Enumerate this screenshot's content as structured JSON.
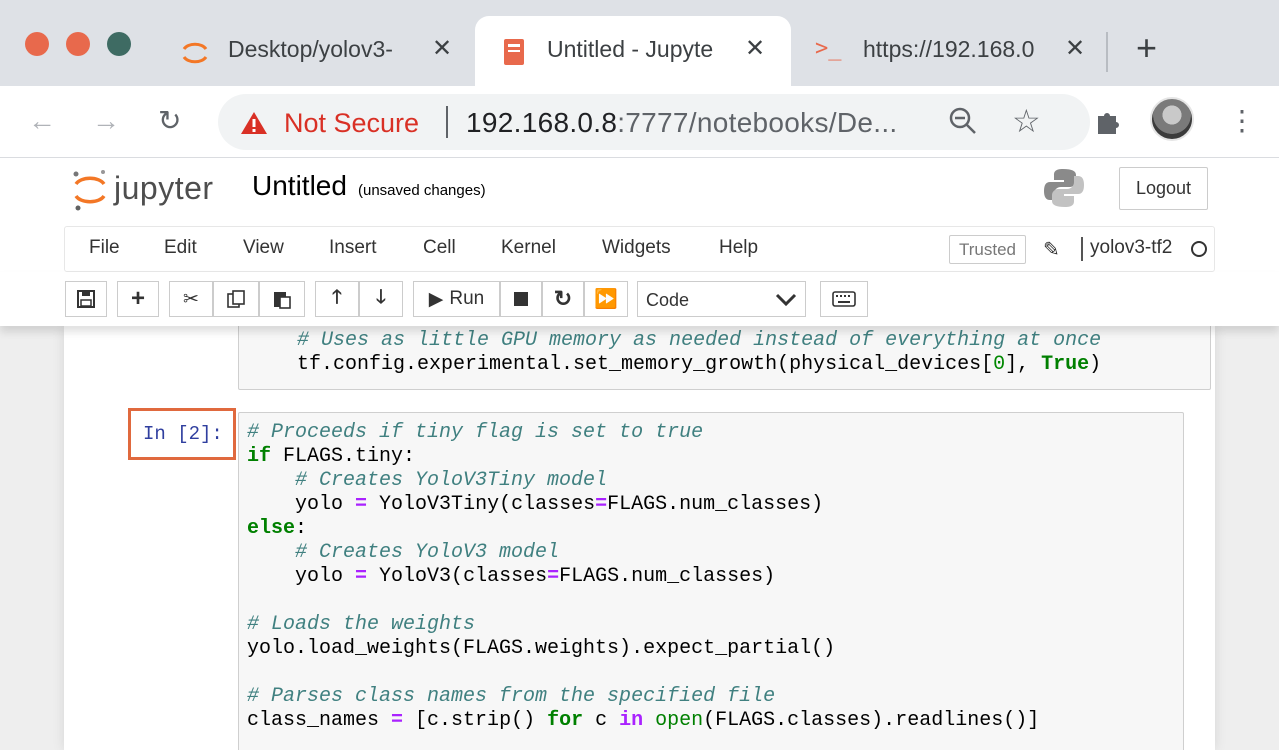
{
  "browser": {
    "tabs": [
      {
        "title": "Desktop/yolov3-"
      },
      {
        "title": "Untitled - Jupyte"
      },
      {
        "title": "https://192.168.0"
      }
    ],
    "security_label": "Not Secure",
    "url_host": "192.168.0.8",
    "url_rest": ":7777/notebooks/De..."
  },
  "jupyter": {
    "logo_text": "jupyter",
    "notebook_name": "Untitled",
    "save_status": "(unsaved changes)",
    "logout_label": "Logout",
    "menu": [
      "File",
      "Edit",
      "View",
      "Insert",
      "Cell",
      "Kernel",
      "Widgets",
      "Help"
    ],
    "trusted_label": "Trusted",
    "kernel_name": "yolov3-tf2",
    "run_label": "Run",
    "cell_type": "Code"
  },
  "cells": [
    {
      "prompt": "",
      "lines": [
        "# Uses as little GPU memory as needed instead of everything at once",
        "tf.config.experimental.set_memory_growth(physical_devices[0], True)"
      ]
    },
    {
      "prompt": "In [2]:",
      "lines": [
        "# Proceeds if tiny flag is set to true",
        "if FLAGS.tiny:",
        "    # Creates YoloV3Tiny model",
        "    yolo = YoloV3Tiny(classes=FLAGS.num_classes)",
        "else:",
        "    # Creates YoloV3 model",
        "    yolo = YoloV3(classes=FLAGS.num_classes)",
        "",
        "# Loads the weights",
        "yolo.load_weights(FLAGS.weights).expect_partial()",
        "",
        "# Parses class names from the specified file",
        "class_names = [c.strip() for c in open(FLAGS.classes).readlines()]"
      ]
    }
  ],
  "colors": {
    "prompt_highlight": "#e0693e",
    "comment": "#408080",
    "keyword": "#008000",
    "not_secure": "#d93025"
  }
}
